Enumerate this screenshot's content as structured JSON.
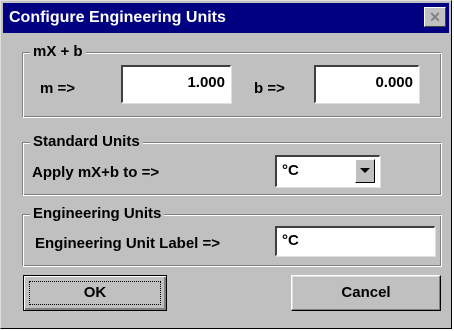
{
  "dialog": {
    "title": "Configure Engineering Units",
    "close_label": "✕"
  },
  "linear": {
    "legend": "mX + b",
    "m_label": "m =>",
    "m_value": "1.000",
    "b_label": "b =>",
    "b_value": "0.000"
  },
  "standard_units": {
    "legend": "Standard Units",
    "apply_label": "Apply mX+b to =>",
    "selected_unit": "°C"
  },
  "engineering_units": {
    "legend": "Engineering Units",
    "label_label": "Engineering Unit Label =>",
    "label_value": "°C"
  },
  "buttons": {
    "ok_label": "OK",
    "cancel_label": "Cancel"
  }
}
